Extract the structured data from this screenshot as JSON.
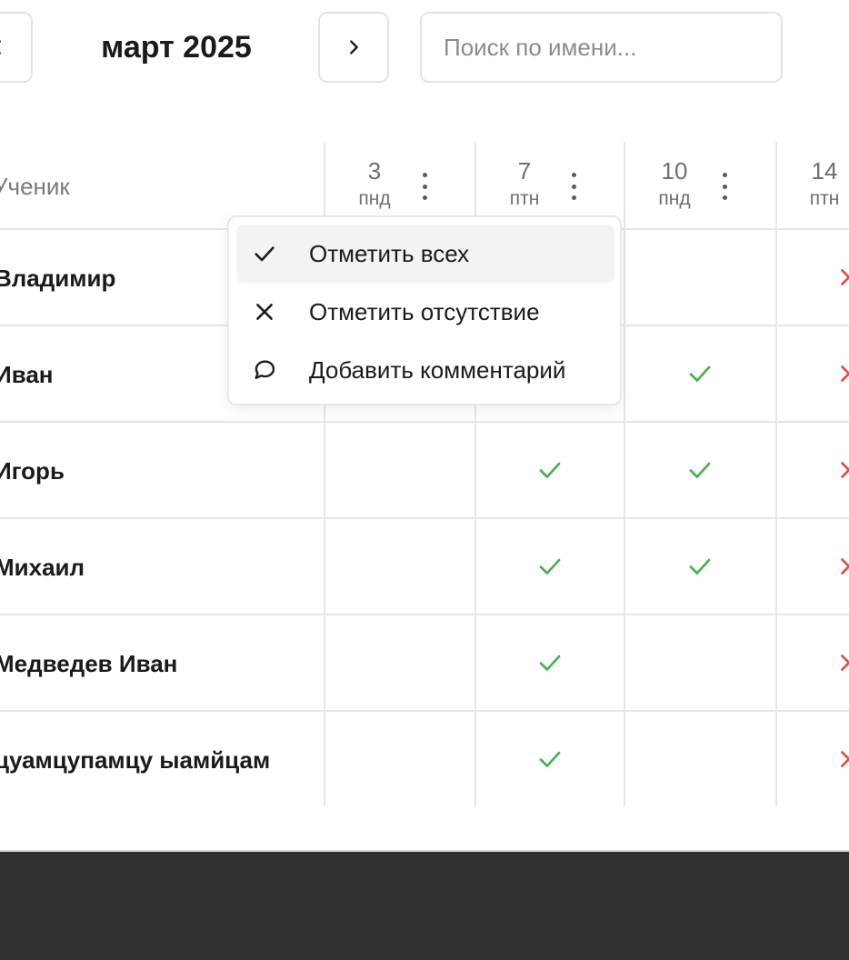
{
  "toolbar": {
    "month_label": "март 2025",
    "search_placeholder": "Поиск по имени...",
    "search_value": ""
  },
  "table": {
    "name_column_title": "Ученик",
    "dates": [
      {
        "day": "3",
        "weekday": "пнд"
      },
      {
        "day": "7",
        "weekday": "птн"
      },
      {
        "day": "10",
        "weekday": "пнд"
      },
      {
        "day": "14",
        "weekday": "птн"
      }
    ],
    "students": [
      {
        "name": "Владимир",
        "marks": [
          "",
          "",
          "",
          "absent"
        ]
      },
      {
        "name": "Иван",
        "marks": [
          "",
          "",
          "present",
          "absent"
        ]
      },
      {
        "name": "Игорь",
        "marks": [
          "",
          "present",
          "present",
          "absent"
        ]
      },
      {
        "name": "Михаил",
        "marks": [
          "",
          "present",
          "present",
          "absent"
        ]
      },
      {
        "name": "Медведев Иван",
        "marks": [
          "",
          "present",
          "",
          "absent"
        ]
      },
      {
        "name": "цуамцупамцу ыамйцам",
        "marks": [
          "",
          "present",
          "",
          "absent"
        ]
      }
    ]
  },
  "context_menu": {
    "items": [
      {
        "label": "Отметить всех",
        "icon": "check-icon"
      },
      {
        "label": "Отметить отсутствие",
        "icon": "x-icon"
      },
      {
        "label": "Добавить комментарий",
        "icon": "comment-icon"
      }
    ]
  },
  "colors": {
    "present": "#4caf50",
    "absent": "#d9534f",
    "footer": "#313131"
  }
}
